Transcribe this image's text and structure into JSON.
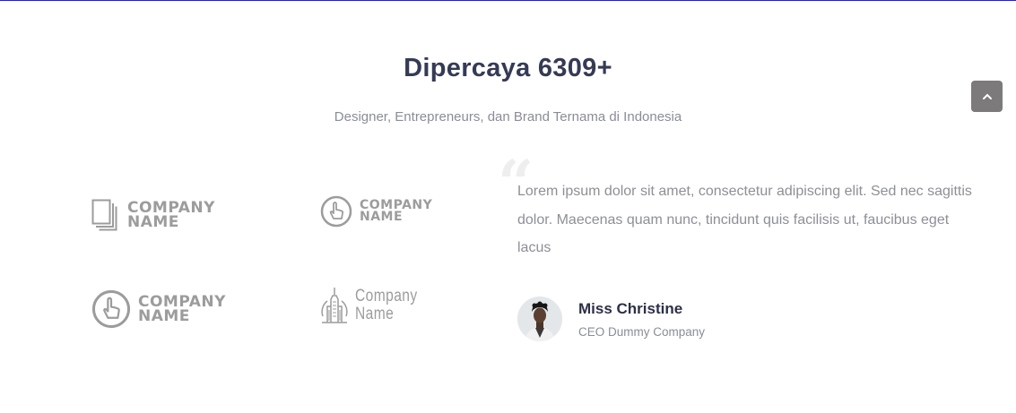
{
  "section": {
    "title": "Dipercaya 6309+",
    "subtitle": "Designer, Entrepreneurs, dan Brand Ternama di Indonesia"
  },
  "logos": [
    {
      "icon": "document-stack-icon",
      "line1": "COMPANY",
      "line2": "NAME"
    },
    {
      "icon": "hand-pointer-circle-icon",
      "line1": "COMPANY",
      "line2": "NAME"
    },
    {
      "icon": "hand-pointer-circle-icon",
      "line1": "COMPANY",
      "line2": "NAME"
    },
    {
      "icon": "skyscraper-globe-icon",
      "line1": "Company",
      "line2": "Name"
    }
  ],
  "testimonial": {
    "quote_mark": "“",
    "text": "Lorem ipsum dolor sit amet, consectetur adipiscing elit. Sed nec sagittis dolor. Maecenas quam nunc, tincidunt quis facilisis ut, faucibus eget lacus",
    "author_name": "Miss Christine",
    "author_title": "CEO Dummy Company"
  },
  "back_to_top": {
    "icon": "chevron-up-icon"
  },
  "colors": {
    "heading": "#353a55",
    "muted_text": "#8a8d98",
    "logo_gray": "#9c9c9c",
    "back_to_top_bg": "#7d7a7b",
    "top_border": "#1a1aff"
  }
}
